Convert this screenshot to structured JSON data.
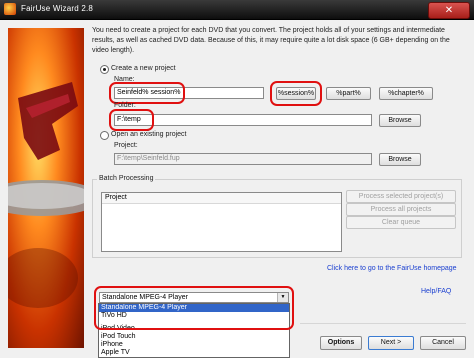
{
  "window": {
    "title": "FairUse Wizard 2.8",
    "close_glyph": "✕"
  },
  "intro_text": "You need to create a project for each DVD that you convert. The project holds all of your settings and intermediate results, as well as cached DVD data. Because of this, it may require quite a lot disk space (6 GB+ depending on the video length).",
  "create_project": {
    "radio_label": "Create a new project",
    "name_label": "Name:",
    "name_value": "Seinfeld% session%",
    "macro_buttons": [
      "%session%",
      "%part%",
      "%chapter%"
    ],
    "folder_label": "Folder:",
    "folder_value": "F:\\temp",
    "browse_label": "Browse"
  },
  "open_project": {
    "radio_label": "Open an existing project",
    "project_label": "Project:",
    "project_value": "F:\\temp\\Seinfeld.fup",
    "browse_label": "Browse"
  },
  "batch": {
    "group_label": "Batch Processing",
    "column_header": "Project",
    "buttons": [
      "Process selected project(s)",
      "Process all projects",
      "Clear queue"
    ]
  },
  "links": {
    "homepage": "Click here to go to the FairUse homepage",
    "help": "Help/FAQ"
  },
  "player_select": {
    "selected": "Standalone MPEG-4 Player",
    "arrow_glyph": "▼",
    "options": [
      "Standalone MPEG-4 Player",
      "TiVo HD",
      "iPod Video",
      "iPod Touch",
      "iPhone",
      "Apple TV"
    ]
  },
  "footer": {
    "options_label": "Options",
    "next_label": "Next >",
    "cancel_label": "Cancel"
  },
  "colors": {
    "highlight": "#e01010",
    "link": "#1a3fd0",
    "selection": "#3165c8"
  }
}
